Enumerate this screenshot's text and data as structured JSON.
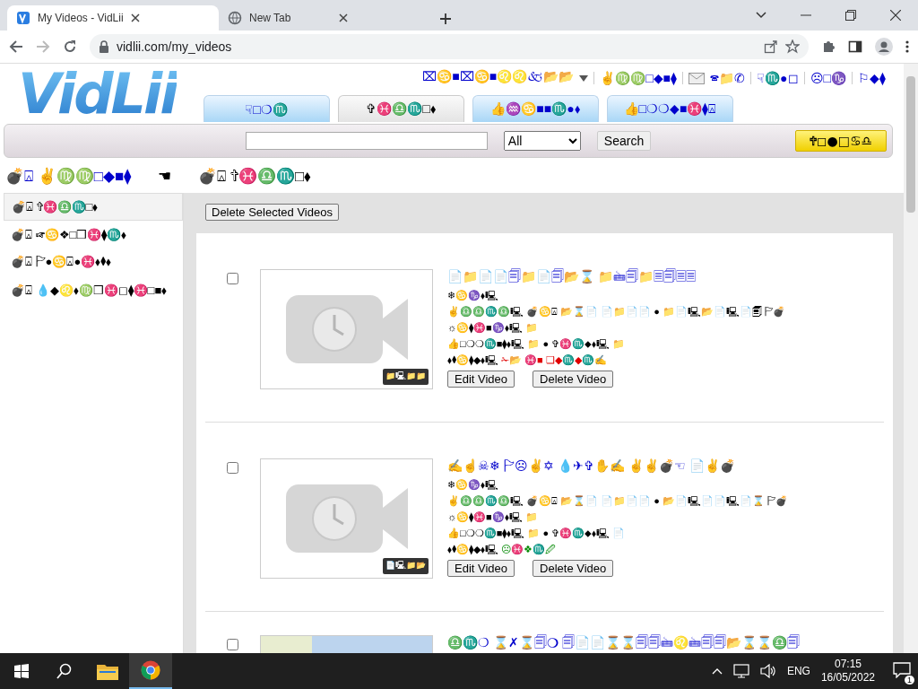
{
  "browser": {
    "tabs": [
      {
        "title": "My Videos - VidLii",
        "selected": true
      },
      {
        "title": "New Tab",
        "selected": false
      }
    ],
    "url": "vidlii.com/my_videos"
  },
  "site": {
    "logo": "VidLii",
    "user_links": [
      {
        "label": "⌧♋■⌧♋■♌♌🙵📂📂",
        "kind": "menu"
      },
      {
        "label": "✌♍♍□◆■⧫",
        "kind": "link"
      },
      {
        "label": "🕿📁✆",
        "kind": "inbox"
      },
      {
        "label": "☟♏●◻",
        "kind": "link"
      },
      {
        "label": "☹□♑",
        "kind": "link"
      },
      {
        "label": "⚐◆⧫",
        "kind": "link"
      }
    ],
    "nav_tabs": [
      {
        "label": "☟□❍♏",
        "selected": false
      },
      {
        "label": "✞♓♎♏□⬧",
        "selected": true
      },
      {
        "label": "👍♒♋■■♏●⬧",
        "selected": false
      },
      {
        "label": "👍□❍❍◆■♓⧫⍓",
        "selected": false
      }
    ],
    "search": {
      "scope": "All",
      "button": "Search"
    },
    "upload_button": "🕆◻●□♋♎"
  },
  "breadcrumb": [
    {
      "label": "💣⍓ ✌♍♍□◆■⧫",
      "kind": "link"
    },
    {
      "label": "☚",
      "kind": "separator"
    },
    {
      "label": "💣⍓ ✞♓♎♏□⬧",
      "kind": "text"
    }
  ],
  "sidebar": [
    {
      "label": "💣⍓ ✞♓♎♏□⬧",
      "selected": true
    },
    {
      "label": "💣⍓ ☞♋❖□❒♓⧫♏⬧",
      "selected": false
    },
    {
      "label": "💣⍓ 🏱●♋⍓●♓⬧⧫⬧",
      "selected": false
    },
    {
      "label": "💣⍓ 💧◆♌⬧♍❒♓◻⧫♓□■⬧",
      "selected": false
    }
  ],
  "delete_selected": "Delete Selected Videos",
  "videos": [
    {
      "checked": false,
      "title": "📄📁📄📄🗐📁📄🗐📂⌛ 📁🖮🗐📁🗏🗐🗏🗏",
      "duration": "📁🖳📁📁",
      "details": [
        "❄♋♑⬧🖳",
        "✌♎♎♏♎🖳 💣♋⍓ 📂⌛📄 📄📁📄📄 ● 📁📄🖳📂📄🖳📄🗐 🏱💣",
        "☼♋⧫♓■♑⬧🖳 📁",
        "👍□❍❍♏■⧫⬧🖳 📁 ● ✞♓♏⬥⬧🖳 📁"
      ],
      "status": {
        "label": "⬧⧫♋⧫◆⬧🖳",
        "text": "✁📂 ♓■ ❑◆♏◆♏✍",
        "color": "#e00000"
      },
      "buttons": [
        "Edit Video",
        "Delete Video"
      ]
    },
    {
      "checked": false,
      "title": "✍☝☠❄ 🏱☹✌✡ 💧✈✞✋✍ ✌✌💣☜ 📄✌💣",
      "duration": "📄🖳📁📂",
      "details": [
        "❄♋♑⬧🖳",
        "✌♎♎♏♎🖳 💣♋⍓ 📂⌛📄 📄📁📄📄 ● 📂📄🖳📄📄🖳📄⌛ 🏱💣",
        "☼♋⧫♓■♑⬧🖳 📁",
        "👍□❍❍♏■⧫⬧🖳 📁 ● ✞♓♏⬥⬧🖳 📄"
      ],
      "status": {
        "label": "⬧⧫♋⧫◆⬧🖳",
        "text": "☹♓❖♏🖉",
        "color": "#008800"
      },
      "buttons": [
        "Edit Video",
        "Delete Video"
      ]
    },
    {
      "checked": false,
      "title": "♎♏❍ ⌛✗⌛🗐❍ 🗐📄📄⌛⌛🗐🗐🖮♌🖮🗐🗐📂⌛⌛♎🗐"
    }
  ],
  "taskbar": {
    "language": "ENG",
    "time": "07:15",
    "date": "16/05/2022",
    "notifications": "1"
  }
}
